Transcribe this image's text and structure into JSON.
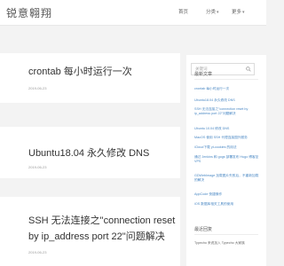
{
  "header": {
    "site_title": "锐意翱翔",
    "nav": {
      "home": "首页",
      "category": "分类",
      "more": "更多"
    }
  },
  "posts": [
    {
      "title": "crontab 每小时运行一次",
      "date": "2019-06-23"
    },
    {
      "title": "Ubuntu18.04 永久修改 DNS",
      "date": "2019-06-23"
    },
    {
      "title": "SSH 无法连接之\"connection reset",
      "title_line2": "by ip_address port 22\"问题解决",
      "date": "2019-06-23"
    }
  ],
  "sidebar": {
    "search": {
      "placeholder": "关键词",
      "icon": "search-icon"
    },
    "recent_title": "最新文章",
    "recent": [
      "crontab 每小时运行一次",
      "Ubuntu18.04 永久修改 DNS",
      "SSH 无法连接之\"connection reset by ip_address port 22\"问题解决",
      "Ubuntu 10.04 修改 DNS",
      "MacOS 使用 SSH 代理连接国外服务",
      "iCloud下载 yt-cookies 的用法",
      "通过 Jenkins 和 gogs 部署发布 Hugo 博客至 VPS",
      "GDWebImage 加载图片失败后，不重新加载的解决",
      "AppCode 快捷操作",
      "iOS 数据库相关工具的使用"
    ],
    "comments_title": "最近回复",
    "comments": [
      "Typecho 来说加入 Typecho 大家族"
    ]
  }
}
